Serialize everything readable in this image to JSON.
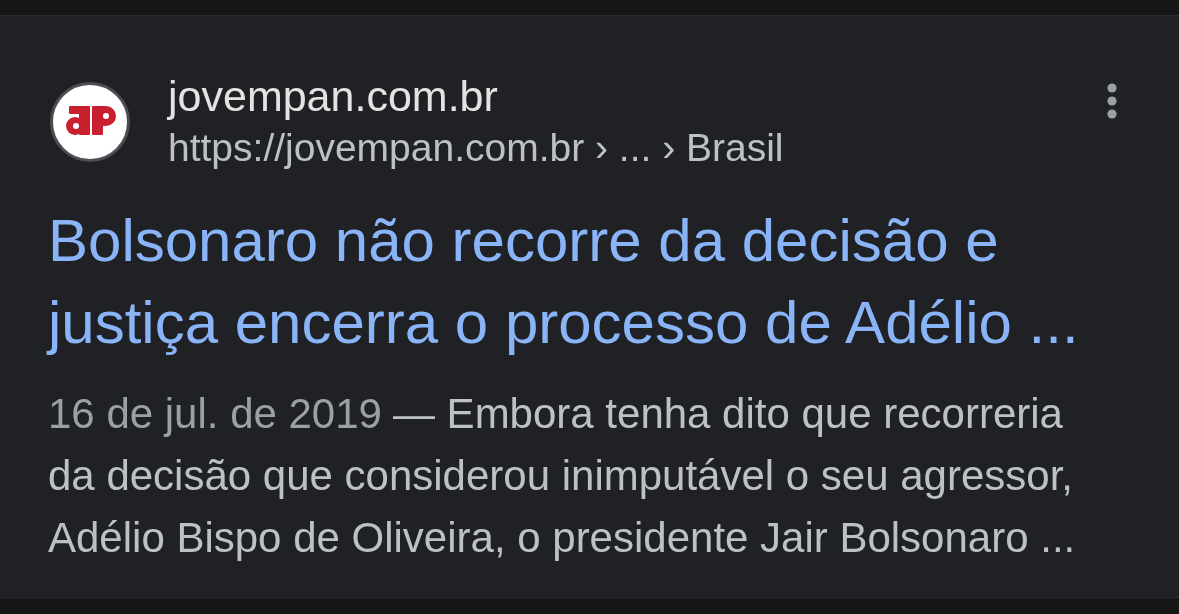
{
  "result": {
    "site_name": "jovempan.com.br",
    "url": "https://jovempan.com.br › ... › Brasil",
    "title": "Bolsonaro não recorre da decisão e\njustiça encerra o processo de Adélio ...",
    "date": "16 de jul. de 2019",
    "snippet": "— Embora tenha dito que recorreria\nda decisão que considerou inimputável o seu agressor,\nAdélio Bispo de Oliveira, o presidente Jair Bolsonaro ..."
  }
}
